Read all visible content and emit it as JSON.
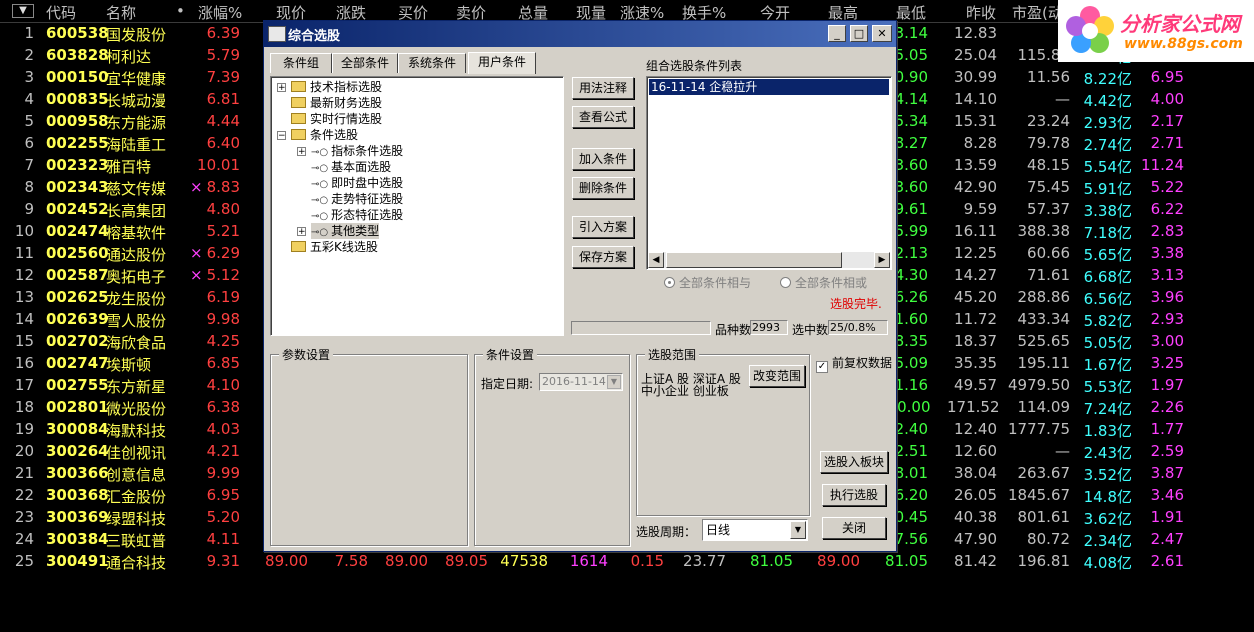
{
  "header": {
    "sort_glyph": "▼",
    "cols": [
      "代码",
      "名称",
      "•",
      "涨幅%",
      "现价",
      "涨跌",
      "买价",
      "卖价",
      "总量",
      "现量",
      "涨速%",
      "换手%",
      "今开",
      "最高",
      "最低",
      "昨收",
      "市盈(动)"
    ]
  },
  "logo": {
    "title": "分析家公式网",
    "url": "www.88gs.com"
  },
  "rows": [
    {
      "i": "1",
      "code": "600538",
      "name": "国发股份",
      "flag": "",
      "pct": "6.39",
      "low": "3.14",
      "prev": "12.83",
      "pe": "",
      "cap": "",
      "rng": ""
    },
    {
      "i": "2",
      "code": "603828",
      "name": "柯利达",
      "flag": "",
      "pct": "5.79",
      "low": "25.05",
      "prev": "25.04",
      "pe": "115.85",
      "cap": "2.12亿",
      "rng": "2.87"
    },
    {
      "i": "3",
      "code": "000150",
      "name": "宜华健康",
      "flag": "",
      "pct": "7.39",
      "low": "30.90",
      "prev": "30.99",
      "pe": "11.56",
      "cap": "8.22亿",
      "rng": "6.95"
    },
    {
      "i": "4",
      "code": "000835",
      "name": "长城动漫",
      "flag": "",
      "pct": "6.81",
      "low": "14.14",
      "prev": "14.10",
      "pe": "—",
      "cap": "4.42亿",
      "rng": "4.00"
    },
    {
      "i": "5",
      "code": "000958",
      "name": "东方能源",
      "flag": "",
      "pct": "4.44",
      "low": "15.34",
      "prev": "15.31",
      "pe": "23.24",
      "cap": "2.93亿",
      "rng": "2.17"
    },
    {
      "i": "6",
      "code": "002255",
      "name": "海陆重工",
      "flag": "",
      "pct": "6.40",
      "low": "8.27",
      "prev": "8.28",
      "pe": "79.78",
      "cap": "2.74亿",
      "rng": "2.71"
    },
    {
      "i": "7",
      "code": "002323",
      "name": "雅百特",
      "flag": "",
      "pct": "10.01",
      "low": "13.60",
      "prev": "13.59",
      "pe": "48.15",
      "cap": "5.54亿",
      "rng": "11.24"
    },
    {
      "i": "8",
      "code": "002343",
      "name": "慈文传媒",
      "flag": "×",
      "pct": "8.83",
      "low": "43.60",
      "prev": "42.90",
      "pe": "75.45",
      "cap": "5.91亿",
      "rng": "5.22"
    },
    {
      "i": "9",
      "code": "002452",
      "name": "长高集团",
      "flag": "",
      "pct": "4.80",
      "low": "9.61",
      "prev": "9.59",
      "pe": "57.37",
      "cap": "3.38亿",
      "rng": "6.22"
    },
    {
      "i": "10",
      "code": "002474",
      "name": "榕基软件",
      "flag": "",
      "pct": "5.21",
      "low": "15.99",
      "prev": "16.11",
      "pe": "388.38",
      "cap": "7.18亿",
      "rng": "2.83"
    },
    {
      "i": "11",
      "code": "002560",
      "name": "通达股份",
      "flag": "×",
      "pct": "6.29",
      "low": "12.13",
      "prev": "12.25",
      "pe": "60.66",
      "cap": "5.65亿",
      "rng": "3.38"
    },
    {
      "i": "12",
      "code": "002587",
      "name": "奥拓电子",
      "flag": "×",
      "pct": "5.12",
      "low": "14.30",
      "prev": "14.27",
      "pe": "71.61",
      "cap": "6.68亿",
      "rng": "3.13"
    },
    {
      "i": "13",
      "code": "002625",
      "name": "龙生股份",
      "flag": "",
      "pct": "6.19",
      "low": "46.26",
      "prev": "45.20",
      "pe": "288.86",
      "cap": "6.56亿",
      "rng": "3.96"
    },
    {
      "i": "14",
      "code": "002639",
      "name": "雪人股份",
      "flag": "",
      "pct": "9.98",
      "low": "11.60",
      "prev": "11.72",
      "pe": "433.34",
      "cap": "5.82亿",
      "rng": "2.93"
    },
    {
      "i": "15",
      "code": "002702",
      "name": "海欣食品",
      "flag": "",
      "pct": "4.25",
      "low": "18.35",
      "prev": "18.37",
      "pe": "525.65",
      "cap": "5.05亿",
      "rng": "3.00"
    },
    {
      "i": "16",
      "code": "002747",
      "name": "埃斯顿",
      "flag": "",
      "pct": "6.85",
      "low": "35.09",
      "prev": "35.35",
      "pe": "195.11",
      "cap": "1.67亿",
      "rng": "3.25"
    },
    {
      "i": "17",
      "code": "002755",
      "name": "东方新星",
      "flag": "",
      "pct": "4.10",
      "low": "51.16",
      "prev": "49.57",
      "pe": "4979.50",
      "cap": "5.53亿",
      "rng": "1.97"
    },
    {
      "i": "18",
      "code": "002801",
      "name": "微光股份",
      "flag": "",
      "pct": "6.38",
      "low": "170.00",
      "prev": "171.52",
      "pe": "114.09",
      "cap": "7.24亿",
      "rng": "2.26"
    },
    {
      "i": "19",
      "code": "300084",
      "name": "海默科技",
      "flag": "",
      "pct": "4.03",
      "low": "12.40",
      "prev": "12.40",
      "pe": "1777.75",
      "cap": "1.83亿",
      "rng": "1.77"
    },
    {
      "i": "20",
      "code": "300264",
      "name": "佳创视讯",
      "flag": "",
      "pct": "4.21",
      "low": "12.51",
      "prev": "12.60",
      "pe": "—",
      "cap": "2.43亿",
      "rng": "2.59"
    },
    {
      "i": "21",
      "code": "300366",
      "name": "创意信息",
      "flag": "",
      "pct": "9.99",
      "low": "38.01",
      "prev": "38.04",
      "pe": "263.67",
      "cap": "3.52亿",
      "rng": "3.87"
    },
    {
      "i": "22",
      "code": "300368",
      "name": "汇金股份",
      "flag": "",
      "pct": "6.95",
      "low": "26.20",
      "prev": "26.05",
      "pe": "1845.67",
      "cap": "14.8亿",
      "rng": "3.46"
    },
    {
      "i": "23",
      "code": "300369",
      "name": "绿盟科技",
      "flag": "",
      "pct": "5.20",
      "low": "40.45",
      "prev": "40.38",
      "pe": "801.61",
      "cap": "3.62亿",
      "rng": "1.91"
    },
    {
      "i": "24",
      "code": "300384",
      "name": "三联虹普",
      "flag": "",
      "pct": "4.11",
      "low": "47.56",
      "prev": "47.90",
      "pe": "80.72",
      "cap": "2.34亿",
      "rng": "2.47"
    }
  ],
  "last_row": {
    "i": "25",
    "code": "300491",
    "name": "通合科技",
    "pct": "9.31",
    "price": "89.00",
    "chg": "7.58",
    "bid": "89.00",
    "ask": "89.05",
    "vol": "47538",
    "cur": "1614",
    "speed": "0.15",
    "turn": "23.77",
    "open": "81.05",
    "high": "89.00",
    "low": "81.05",
    "prev": "81.42",
    "pe": "196.81",
    "cap": "4.08亿",
    "rng": "2.61"
  },
  "dialog": {
    "title": "综合选股",
    "tabs": [
      "条件组",
      "全部条件",
      "系统条件",
      "用户条件"
    ],
    "tree": {
      "root1": "技术指标选股",
      "root2": "最新财务选股",
      "root3": "实时行情选股",
      "root4": "条件选股",
      "c1": "指标条件选股",
      "c2": "基本面选股",
      "c3": "即时盘中选股",
      "c4": "走势特征选股",
      "c5": "形态特征选股",
      "c6": "其他类型",
      "root5": "五彩K线选股"
    },
    "mid_buttons": [
      "用法注释",
      "查看公式",
      "加入条件",
      "删除条件",
      "引入方案",
      "保存方案"
    ],
    "list_title": "组合选股条件列表",
    "list_item": "16-11-14 企稳拉升",
    "radio_and": "全部条件相与",
    "radio_or": "全部条件相或",
    "status": "选股完毕.",
    "count_label": "品种数",
    "count_value": "2993",
    "selected_label": "选中数",
    "selected_value": "25/0.8%",
    "params_title": "参数设置",
    "cond_title": "条件设置",
    "date_label": "指定日期:",
    "date_value": "2016-11-14",
    "range_title": "选股范围",
    "range_text1": "上证A 股  深证A 股",
    "range_text2": "中小企业  创业板",
    "change_range": "改变范围",
    "adjust_label": "前复权数据",
    "to_block": "选股入板块",
    "exec": "执行选股",
    "close": "关闭",
    "period_label": "选股周期：",
    "period_value": "日线"
  }
}
